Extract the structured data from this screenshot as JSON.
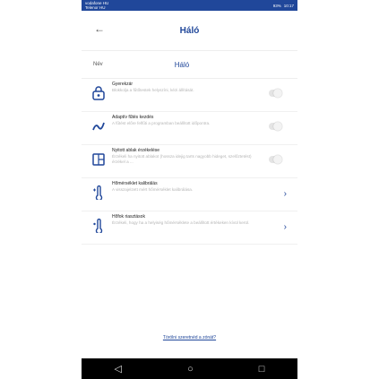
{
  "status": {
    "carrier": "vodafone HU\nTelenor HU",
    "battery": "93%",
    "time": "10:17"
  },
  "header": {
    "back_icon": "back-arrow-icon",
    "title": "Háló"
  },
  "name_row": {
    "label": "Név",
    "value": "Háló"
  },
  "items": [
    {
      "title": "Gyerekzár",
      "desc": "Blokkolja a fűtőtestek helyszíni, kézi állítását.",
      "icon": "lock-icon",
      "control": "toggle"
    },
    {
      "title": "Adaptív fűtés kezdés",
      "desc": "A fűtést előre felfűti a programban beállított időpontra.",
      "icon": "adaptive-curve-icon",
      "control": "toggle"
    },
    {
      "title": "Nyitott ablak érzékelése",
      "desc": "Érzékeli ha nyitott ablakot (hossza idejig tarts nagyobb hideget, szelőztetést) érzékel a ...",
      "icon": "window-icon",
      "control": "toggle"
    },
    {
      "title": "Hőmérséklet kalibrálás",
      "desc": "A visszajelzett mért hőmérséklet kalibrálása.",
      "icon": "thermometer-plus-minus-icon",
      "control": "chevron"
    },
    {
      "title": "Hőfok riasztások",
      "desc": "Érzékeli, hogy ha a helyiség hőmérséklete a beállított értékeken kívül kerül.",
      "icon": "thermometer-alert-icon",
      "control": "chevron"
    }
  ],
  "delete_link": "Törölni szeretnéd a zónát?",
  "navbar": {
    "back": "◁",
    "home": "○",
    "recent": "□"
  }
}
